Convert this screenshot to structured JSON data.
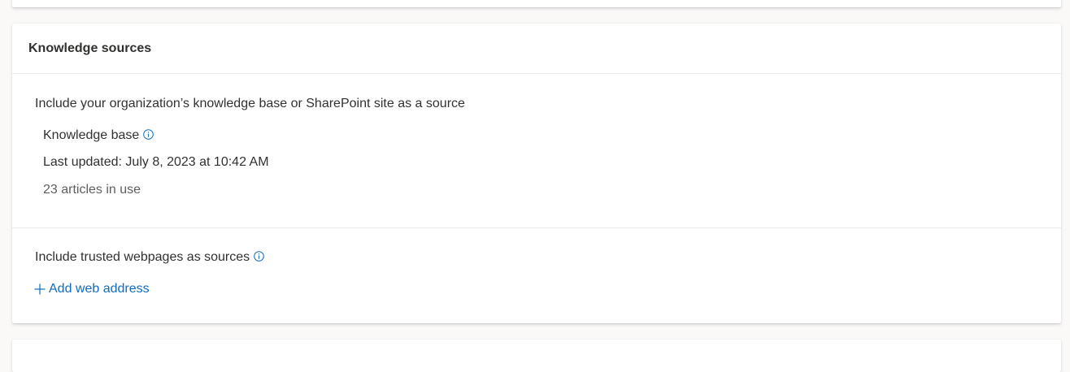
{
  "knowledge_card": {
    "title": "Knowledge sources",
    "knowledge_base_section": {
      "description": "Include your organization’s knowledge base or SharePoint site as a source",
      "label": "Knowledge base",
      "last_updated": "Last updated: July 8, 2023 at 10:42 AM",
      "article_count": "23 articles in use"
    },
    "web_section": {
      "description": "Include trusted webpages as sources",
      "add_link_label": "Add web address"
    }
  },
  "icons": {
    "info": "info-icon",
    "add": "plus-icon"
  },
  "colors": {
    "accent": "#0f6cbd",
    "text_primary": "#323130",
    "text_secondary": "#605e5c",
    "divider": "#edebe9"
  }
}
